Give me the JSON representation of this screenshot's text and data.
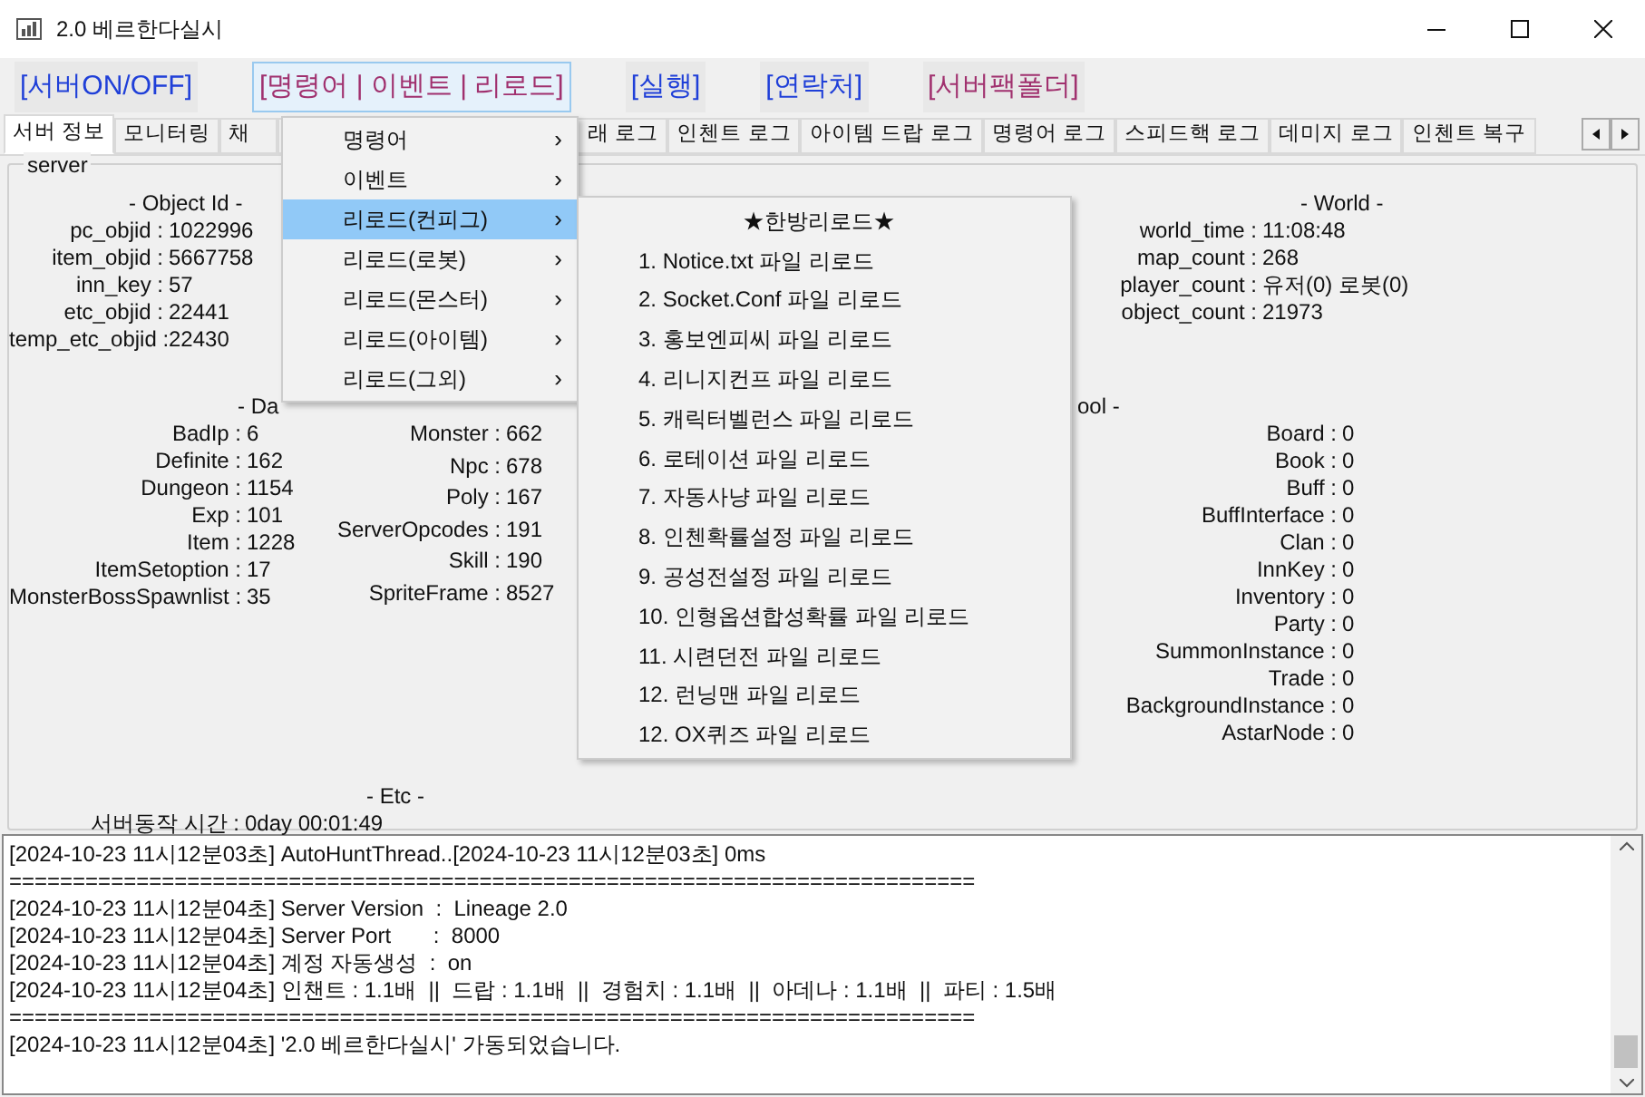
{
  "window": {
    "title": "2.0 베르한다실시"
  },
  "toolbar": [
    {
      "label": "[서버ON/OFF]",
      "color": "#1f3fd8",
      "selected": false
    },
    {
      "label": "[명령어 | 이벤트 | 리로드]",
      "color": "#a0306e",
      "selected": true
    },
    {
      "label": "[실행]",
      "color": "#1f3fd8",
      "selected": false
    },
    {
      "label": "[연락처]",
      "color": "#1f3fd8",
      "selected": false
    },
    {
      "label": "[서버팩폴더]",
      "color": "#a0306e",
      "selected": false
    }
  ],
  "tabs": [
    {
      "label": "서버 정보",
      "selected": true
    },
    {
      "label": "모니터링",
      "selected": false
    },
    {
      "label": "채",
      "selected": false
    },
    {
      "label": "래 로그",
      "selected": false
    },
    {
      "label": "인첸트 로그",
      "selected": false
    },
    {
      "label": "아이템 드랍 로그",
      "selected": false
    },
    {
      "label": "명령어 로그",
      "selected": false
    },
    {
      "label": "스피드핵 로그",
      "selected": false
    },
    {
      "label": "데미지 로그",
      "selected": false
    },
    {
      "label": "인첸트 복구",
      "selected": false
    }
  ],
  "server": {
    "title": "server",
    "object_id": {
      "heading": "- Object Id -",
      "rows": [
        {
          "label": "pc_objid :",
          "value": "1022996"
        },
        {
          "label": "item_objid :",
          "value": "5667758"
        },
        {
          "label": "inn_key :",
          "value": "57"
        },
        {
          "label": "etc_objid :",
          "value": "22441"
        },
        {
          "label": "temp_etc_objid :",
          "value": "22430"
        }
      ]
    },
    "world": {
      "heading": "- World -",
      "rows": [
        {
          "label": "world_time :",
          "value": "11:08:48"
        },
        {
          "label": "map_count :",
          "value": "268"
        },
        {
          "label": "player_count :",
          "value": "유저(0) 로봇(0)"
        },
        {
          "label": "object_count :",
          "value": "21973"
        }
      ]
    },
    "database": {
      "heading": "- Da",
      "left": [
        {
          "label": "BadIp :",
          "value": "6"
        },
        {
          "label": "Definite :",
          "value": "162"
        },
        {
          "label": "Dungeon :",
          "value": "1154"
        },
        {
          "label": "Exp :",
          "value": "101"
        },
        {
          "label": "Item :",
          "value": "1228"
        },
        {
          "label": "ItemSetoption :",
          "value": "17"
        },
        {
          "label": "MonsterBossSpawnlist :",
          "value": "35"
        }
      ],
      "right": [
        {
          "label": "Monster :",
          "value": "662"
        },
        {
          "label": "Npc :",
          "value": "678"
        },
        {
          "label": "Poly :",
          "value": "167"
        },
        {
          "label": "ServerOpcodes :",
          "value": "191"
        },
        {
          "label": "Skill :",
          "value": "190"
        },
        {
          "label": "SpriteFrame :",
          "value": "8527"
        }
      ]
    },
    "pool": {
      "heading": "ool -",
      "rows": [
        {
          "label": "Board :",
          "value": "0"
        },
        {
          "label": "Book :",
          "value": "0"
        },
        {
          "label": "Buff :",
          "value": "0"
        },
        {
          "label": "BuffInterface :",
          "value": "0"
        },
        {
          "label": "Clan :",
          "value": "0"
        },
        {
          "label": "InnKey :",
          "value": "0"
        },
        {
          "label": "Inventory :",
          "value": "0"
        },
        {
          "label": "Party :",
          "value": "0"
        },
        {
          "label": "SummonInstance :",
          "value": "0"
        },
        {
          "label": "Trade :",
          "value": "0"
        },
        {
          "label": "BackgroundInstance :",
          "value": "0"
        },
        {
          "label": "AstarNode :",
          "value": "0"
        }
      ]
    },
    "etc": {
      "heading": "- Etc -",
      "rows": [
        {
          "label": "서버동작 시간 :",
          "value": "0day 00:01:49"
        }
      ]
    }
  },
  "menu": [
    {
      "label": "명령어",
      "arrow": "›",
      "selected": false
    },
    {
      "label": "이벤트",
      "arrow": "›",
      "selected": false
    },
    {
      "label": "리로드(컨피그)",
      "arrow": "›",
      "selected": true
    },
    {
      "label": "리로드(로봇)",
      "arrow": "›",
      "selected": false
    },
    {
      "label": "리로드(몬스터)",
      "arrow": "›",
      "selected": false
    },
    {
      "label": "리로드(아이템)",
      "arrow": "›",
      "selected": false
    },
    {
      "label": "리로드(그외)",
      "arrow": "›",
      "selected": false
    }
  ],
  "submenu": [
    {
      "label": "★한방리로드★",
      "kind": "header"
    },
    {
      "label": "1. Notice.txt 파일 리로드",
      "kind": "item"
    },
    {
      "label": "2. Socket.Conf 파일 리로드",
      "kind": "item"
    },
    {
      "label": "3. 홍보엔피씨 파일 리로드",
      "kind": "item"
    },
    {
      "label": "4. 리니지컨프 파일 리로드",
      "kind": "item"
    },
    {
      "label": "5. 캐릭터벨런스 파일 리로드",
      "kind": "item"
    },
    {
      "label": "6. 로테이션 파일 리로드",
      "kind": "item"
    },
    {
      "label": "7. 자동사냥 파일 리로드",
      "kind": "item"
    },
    {
      "label": "8. 인첸확률설정 파일 리로드",
      "kind": "item"
    },
    {
      "label": "9. 공성전설정 파일 리로드",
      "kind": "item"
    },
    {
      "label": "10. 인형옵션합성확률 파일 리로드",
      "kind": "item"
    },
    {
      "label": "11. 시련던전 파일 리로드",
      "kind": "item"
    },
    {
      "label": "12. 런닝맨 파일 리로드",
      "kind": "item"
    },
    {
      "label": "12. OX퀴즈 파일 리로드",
      "kind": "item"
    }
  ],
  "log": [
    "[2024-10-23 11시12분03초] AutoHuntThread..[2024-10-23 11시12분03초] 0ms",
    "============================================================================",
    "[2024-10-23 11시12분04초] Server Version  :  Lineage 2.0",
    "[2024-10-23 11시12분04초] Server Port       :  8000",
    "[2024-10-23 11시12분04초] 계정 자동생성  :  on",
    "[2024-10-23 11시12분04초] 인챈트 : 1.1배  ||  드랍 : 1.1배  ||  경험치 : 1.1배  ||  아데나 : 1.1배  ||  파티 : 1.5배",
    "============================================================================",
    "[2024-10-23 11시12분04초] '2.0 베르한다실시' 가동되었습니다."
  ]
}
